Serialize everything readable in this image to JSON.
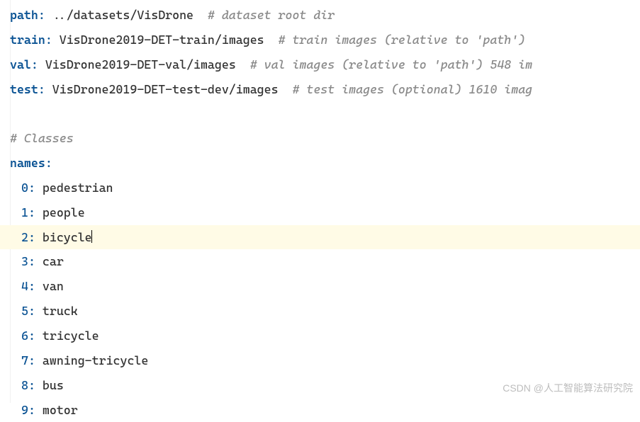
{
  "header": {
    "path_key": "path",
    "path_val": "../datasets/VisDrone",
    "path_comment": "# dataset root dir",
    "train_key": "train",
    "train_val": "VisDrone2019-DET-train/images",
    "train_comment": "# train images (relative to 'path')",
    "val_key": "val",
    "val_val": "VisDrone2019-DET-val/images",
    "val_comment": "# val images (relative to 'path')  548 im",
    "test_key": "test",
    "test_val": "VisDrone2019-DET-test-dev/images",
    "test_comment": "# test images (optional)  1610 imag"
  },
  "classes_comment": "# Classes",
  "names_key": "names",
  "classes": [
    {
      "idx": "0",
      "name": "pedestrian"
    },
    {
      "idx": "1",
      "name": "people"
    },
    {
      "idx": "2",
      "name": "bicycle"
    },
    {
      "idx": "3",
      "name": "car"
    },
    {
      "idx": "4",
      "name": "van"
    },
    {
      "idx": "5",
      "name": "truck"
    },
    {
      "idx": "6",
      "name": "tricycle"
    },
    {
      "idx": "7",
      "name": "awning-tricycle"
    },
    {
      "idx": "8",
      "name": "bus"
    },
    {
      "idx": "9",
      "name": "motor"
    }
  ],
  "highlighted_index": 2,
  "watermark": "CSDN @人工智能算法研究院"
}
